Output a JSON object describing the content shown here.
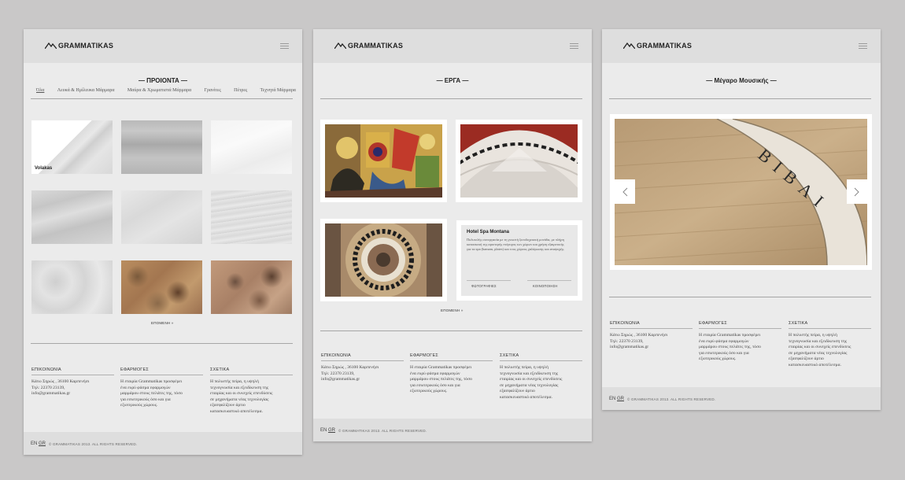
{
  "brand": {
    "logo_text": "GRAMMATIKAS"
  },
  "products_page": {
    "section_title": "— ΠΡΟΙΟΝΤΑ —",
    "tabs": [
      "Όλα",
      "Λευκά & Ημίλευκα Μάρμαρα",
      "Μαύρα & Χρωματιστά Μάρμαρα",
      "Γρανίτες",
      "Πέτρες",
      "Τεχνητά Μάρμαρα"
    ],
    "active_tab": "Όλα",
    "first_tile_caption": "Volakas",
    "more_label": "ΕΠΟΜΕΝΗ »"
  },
  "projects_page": {
    "section_title": "— ΕΡΓΑ —",
    "feature": {
      "title": "Hotel Spa Montana",
      "description": "Πολυτελής συνεργασία με τη γνωστή ξενοδοχειακή μονάδα, με πλήρη κατασκευή της αριστερής πτέρυγας των χώρων και χρήση εξαιρετικής για τα spa (hamam, plates) και τους χώρους χαλάρωσης και αναψυχής.",
      "links": [
        "ΦΩΤΟΓΡΑΦΙΕΣ",
        "ΚΟΙΝΟΠΟΙΗΣΗ"
      ]
    },
    "more_label": "ΕΠΟΜΕΝΗ »"
  },
  "project_detail_page": {
    "section_title": "— Μέγαρο Μουσικής —",
    "slide_letters": "ΒΙΒΛΙ"
  },
  "footer": {
    "contact_heading": "ΕΠΙΚΟΙΝΩΝΙΑ",
    "contact_text": "Κάτω Σηρώς , 36100 Καρπενήσι\nΤηλ: 22370 23139,\ninfo@grammatikas.gr",
    "applications_heading": "ΕΦΑΡΜΟΓΕΣ",
    "applications_text": "Η εταιρία Grammatikas προσφέρει\nένα ευρύ φάσμα εφαρμογών\nμαρμάρου στους πελάτες της, τόσο\nγια εσωτερικούς όσο και για\nεξωτερικούς χώρους.",
    "about_heading": "ΣΧΕΤΙΚΑ",
    "about_text": "Η πολυετής πείρα, η υψηλή\nτεχνογνωσία και εξειδίκευση της\nεταιρίας και οι συνεχείς επενδύσεις\nσε μηχανήματα νέας τεχνολογίας\nεξασφαλίζουν άρτιο\nκατασκευαστικό αποτέλεσμα."
  },
  "bottom": {
    "lang_en": "EN",
    "lang_gr": "GR",
    "copyright": "© GRAMMATIKAS 2013. ALL RIGHTS RESERVED."
  },
  "colors": {
    "background": "#c9c8c8",
    "page": "#ebebeb",
    "bar": "#dedede",
    "text": "#333333"
  }
}
